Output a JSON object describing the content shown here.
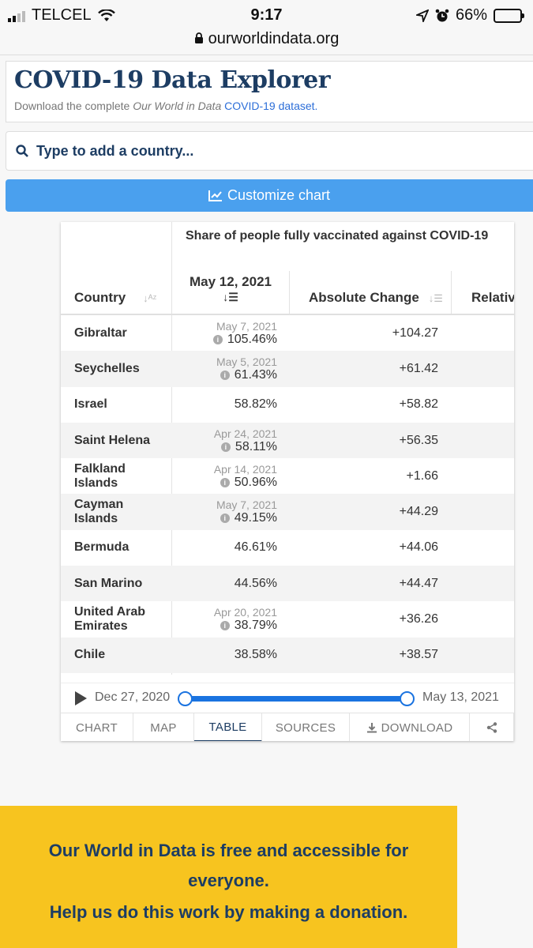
{
  "status_bar": {
    "carrier": "TELCEL",
    "time": "9:17",
    "battery": "66%",
    "battery_level": 0.66,
    "url": "ourworldindata.org"
  },
  "header": {
    "title": "COVID-19 Data Explorer",
    "subtitle_prefix": "Download the complete ",
    "subtitle_em": "Our World in Data",
    "subtitle_link": "COVID-19 dataset."
  },
  "search": {
    "placeholder": "Type to add a country..."
  },
  "customize_button": "Customize chart",
  "table": {
    "title": "Share of people fully vaccinated against COVID-19",
    "columns": {
      "country": "Country",
      "date": "May 12, 2021",
      "absolute": "Absolute Change",
      "relative": "Relativ"
    },
    "rows": [
      {
        "name": "Gibraltar",
        "note": "May 7, 2021",
        "value": "105.46%",
        "info": true,
        "abs": "+104.27"
      },
      {
        "name": "Seychelles",
        "note": "May 5, 2021",
        "value": "61.43%",
        "info": true,
        "abs": "+61.42"
      },
      {
        "name": "Israel",
        "note": "",
        "value": "58.82%",
        "info": false,
        "abs": "+58.82"
      },
      {
        "name": "Saint Helena",
        "note": "Apr 24, 2021",
        "value": "58.11%",
        "info": true,
        "abs": "+56.35"
      },
      {
        "name": "Falkland Islands",
        "note": "Apr 14, 2021",
        "value": "50.96%",
        "info": true,
        "abs": "+1.66"
      },
      {
        "name": "Cayman Islands",
        "note": "May 7, 2021",
        "value": "49.15%",
        "info": true,
        "abs": "+44.29"
      },
      {
        "name": "Bermuda",
        "note": "",
        "value": "46.61%",
        "info": false,
        "abs": "+44.06"
      },
      {
        "name": "San Marino",
        "note": "",
        "value": "44.56%",
        "info": false,
        "abs": "+44.47"
      },
      {
        "name": "United Arab Emirates",
        "note": "Apr 20, 2021",
        "value": "38.79%",
        "info": true,
        "abs": "+36.26"
      },
      {
        "name": "Chile",
        "note": "",
        "value": "38.58%",
        "info": false,
        "abs": "+38.57"
      }
    ]
  },
  "timeline": {
    "start": "Dec 27, 2020",
    "end": "May 13, 2021",
    "start_pos": 0,
    "end_pos": 1
  },
  "tabs": [
    "CHART",
    "MAP",
    "TABLE",
    "SOURCES",
    "DOWNLOAD",
    ""
  ],
  "active_tab": "TABLE",
  "donation": {
    "line1": "Our World in Data is free and accessible for everyone.",
    "line2": "Help us do this work by making a donation."
  },
  "colors": {
    "accent": "#1d3d63",
    "button": "#4aa0ee",
    "slider": "#1a73e0",
    "banner": "#f7c41f"
  }
}
